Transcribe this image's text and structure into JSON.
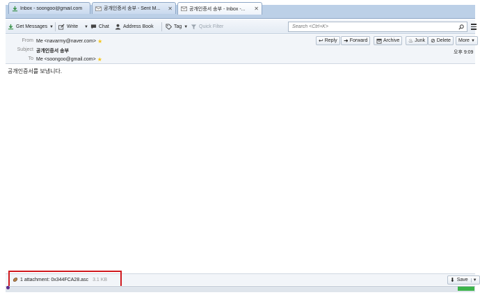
{
  "tabs": [
    {
      "label": "Inbox - soongoo@gmail.com",
      "closable": false
    },
    {
      "label": "공개인증서 송부 - Sent M...",
      "closable": true
    },
    {
      "label": "공개인증서 송부 - Inbox -...",
      "closable": true
    }
  ],
  "toolbar": {
    "get_messages": "Get Messages",
    "write": "Write",
    "chat": "Chat",
    "address_book": "Address Book",
    "tag": "Tag",
    "quick_filter": "Quick Filter",
    "search_placeholder": "Search <Ctrl+K>"
  },
  "header": {
    "from_label": "From",
    "from_value": "Me <navarmy@naver.com>",
    "subject_label": "Subject",
    "subject_value": "공개인증서 송부",
    "to_label": "To",
    "to_value": "Me <soongoo@gmail.com>",
    "time": "오후 9:09",
    "actions": {
      "reply": "Reply",
      "forward": "Forward",
      "archive": "Archive",
      "junk": "Junk",
      "delete": "Delete",
      "more": "More"
    }
  },
  "message": {
    "body": "공개인증서를 보냅니다."
  },
  "attachment": {
    "summary": "1 attachment: 0x344FCA28.asc",
    "size": "3.1 KB",
    "save": "Save"
  },
  "colors": {
    "highlight": "#d0191e",
    "status_green": "#3cb44b",
    "tabstrip": "#bcd0e7"
  }
}
